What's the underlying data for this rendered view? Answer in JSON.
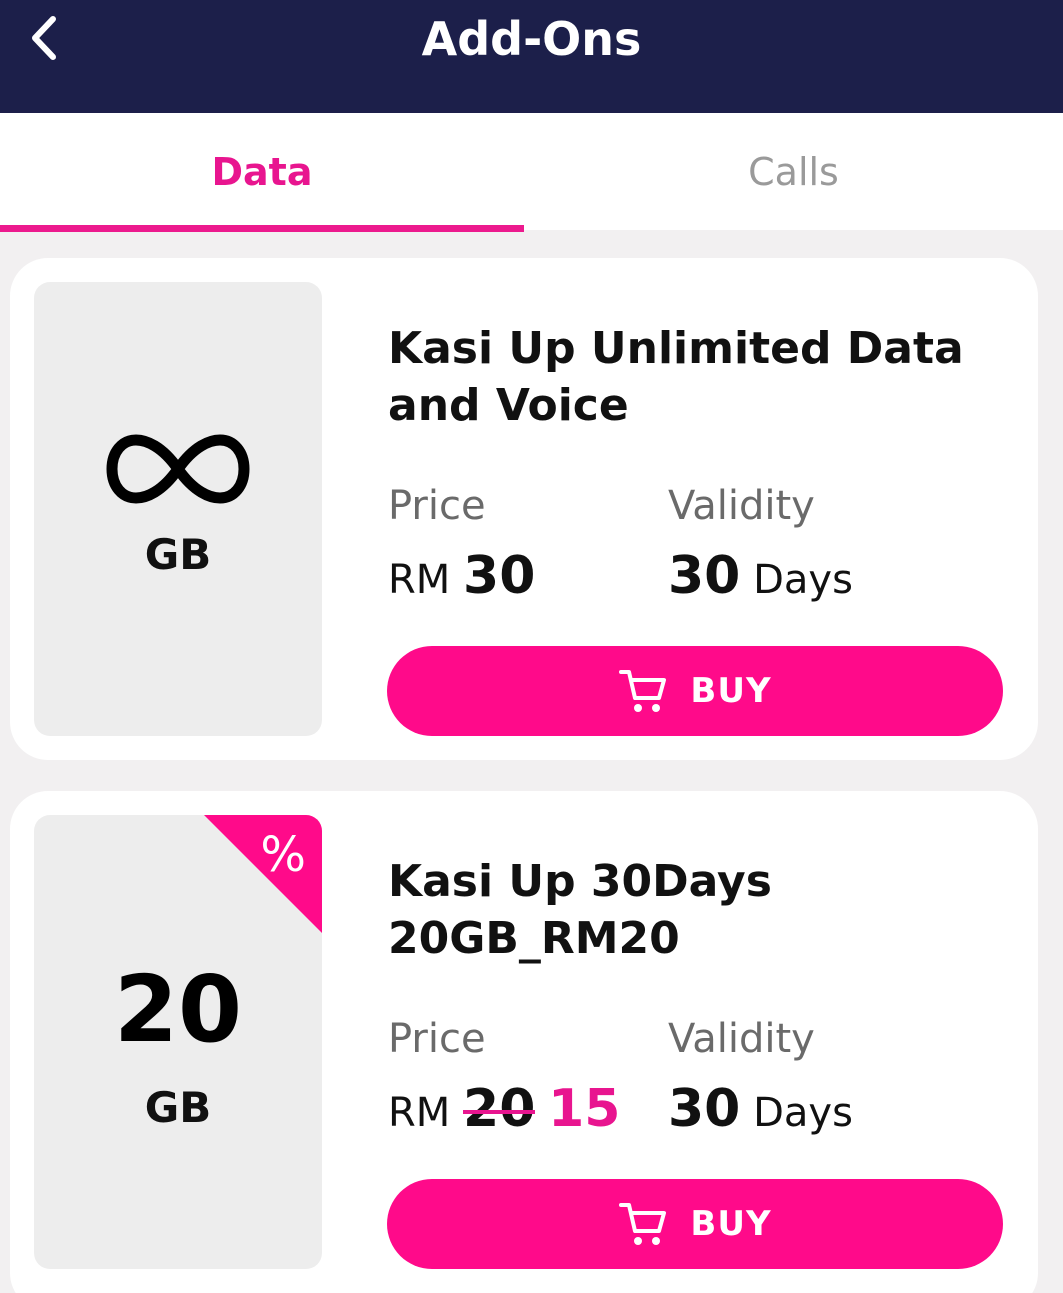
{
  "header": {
    "title": "Add-Ons",
    "back_icon": "chevron-left-icon",
    "background": "#1c1f4a"
  },
  "tabs": [
    {
      "label": "Data",
      "active": true
    },
    {
      "label": "Calls",
      "active": false
    }
  ],
  "accent_color": "#ff0a8a",
  "cards": [
    {
      "thumb_icon": "infinity-icon",
      "unit": "GB",
      "title_line1": "Kasi Up Unlimited Data",
      "title_line2": "and Voice",
      "price_label": "Price",
      "currency": "RM",
      "price": "30",
      "validity_label": "Validity",
      "validity_value": "30",
      "validity_unit": "Days",
      "buy_label": "BUY"
    },
    {
      "data_amount": "20",
      "unit": "GB",
      "badge_icon": "percent-icon",
      "badge_text": "%",
      "title_line1": "Kasi Up 30Days",
      "title_line2": "20GB_RM20",
      "price_label": "Price",
      "currency": "RM",
      "original_price": "20",
      "discounted_price": "15",
      "validity_label": "Validity",
      "validity_value": "30",
      "validity_unit": "Days",
      "buy_label": "BUY"
    }
  ]
}
